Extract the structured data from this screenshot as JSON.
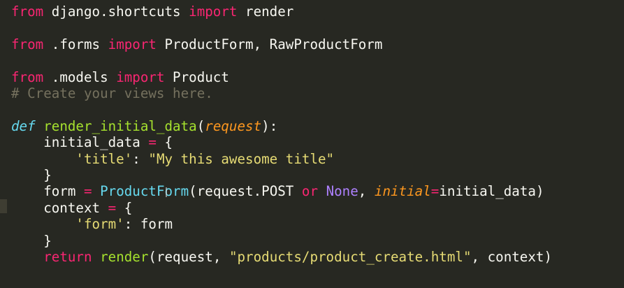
{
  "editor": {
    "lines": [
      {
        "tokens": [
          {
            "t": "from",
            "c": "kw"
          },
          {
            "t": " django.shortcuts ",
            "c": "plain"
          },
          {
            "t": "import",
            "c": "kw"
          },
          {
            "t": " render",
            "c": "plain"
          }
        ]
      },
      {
        "tokens": []
      },
      {
        "tokens": [
          {
            "t": "from",
            "c": "kw"
          },
          {
            "t": " .forms ",
            "c": "plain"
          },
          {
            "t": "import",
            "c": "kw"
          },
          {
            "t": " ProductForm, RawProductForm",
            "c": "plain"
          }
        ]
      },
      {
        "tokens": []
      },
      {
        "tokens": [
          {
            "t": "from",
            "c": "kw"
          },
          {
            "t": " .models ",
            "c": "plain"
          },
          {
            "t": "import",
            "c": "kw"
          },
          {
            "t": " Product",
            "c": "plain"
          }
        ]
      },
      {
        "tokens": [
          {
            "t": "# Create your views here.",
            "c": "comment"
          }
        ]
      },
      {
        "tokens": []
      },
      {
        "tokens": [
          {
            "t": "def",
            "c": "def"
          },
          {
            "t": " ",
            "c": "plain"
          },
          {
            "t": "render_initial_data",
            "c": "fn"
          },
          {
            "t": "(",
            "c": "plain"
          },
          {
            "t": "request",
            "c": "param"
          },
          {
            "t": "):",
            "c": "plain"
          }
        ]
      },
      {
        "tokens": [
          {
            "t": "    initial_data ",
            "c": "plain"
          },
          {
            "t": "=",
            "c": "op"
          },
          {
            "t": " {",
            "c": "plain"
          }
        ]
      },
      {
        "tokens": [
          {
            "t": "        ",
            "c": "plain"
          },
          {
            "t": "'title'",
            "c": "str"
          },
          {
            "t": ": ",
            "c": "plain"
          },
          {
            "t": "\"My this awesome title\"",
            "c": "str"
          }
        ]
      },
      {
        "tokens": [
          {
            "t": "    }",
            "c": "plain"
          }
        ]
      },
      {
        "tokens": [
          {
            "t": "    form ",
            "c": "plain"
          },
          {
            "t": "=",
            "c": "op"
          },
          {
            "t": " ",
            "c": "plain"
          },
          {
            "t": "ProductForm",
            "c": "cls"
          },
          {
            "t": "(request.POST ",
            "c": "plain"
          },
          {
            "t": "or",
            "c": "kw"
          },
          {
            "t": " ",
            "c": "plain"
          },
          {
            "t": "None",
            "c": "const"
          },
          {
            "t": ", ",
            "c": "plain"
          },
          {
            "t": "initial",
            "c": "param"
          },
          {
            "t": "=",
            "c": "op"
          },
          {
            "t": "initial_data)",
            "c": "plain"
          }
        ]
      },
      {
        "tokens": [
          {
            "t": "    context ",
            "c": "plain"
          },
          {
            "t": "=",
            "c": "op"
          },
          {
            "t": " {",
            "c": "plain"
          }
        ]
      },
      {
        "tokens": [
          {
            "t": "        ",
            "c": "plain"
          },
          {
            "t": "'form'",
            "c": "str"
          },
          {
            "t": ": form",
            "c": "plain"
          }
        ]
      },
      {
        "tokens": [
          {
            "t": "    }",
            "c": "plain"
          }
        ]
      },
      {
        "tokens": [
          {
            "t": "    ",
            "c": "plain"
          },
          {
            "t": "return",
            "c": "kw"
          },
          {
            "t": " ",
            "c": "plain"
          },
          {
            "t": "render",
            "c": "fn"
          },
          {
            "t": "(request, ",
            "c": "plain"
          },
          {
            "t": "\"products/product_create.html\"",
            "c": "str"
          },
          {
            "t": ", context)",
            "c": "plain"
          }
        ]
      }
    ]
  }
}
